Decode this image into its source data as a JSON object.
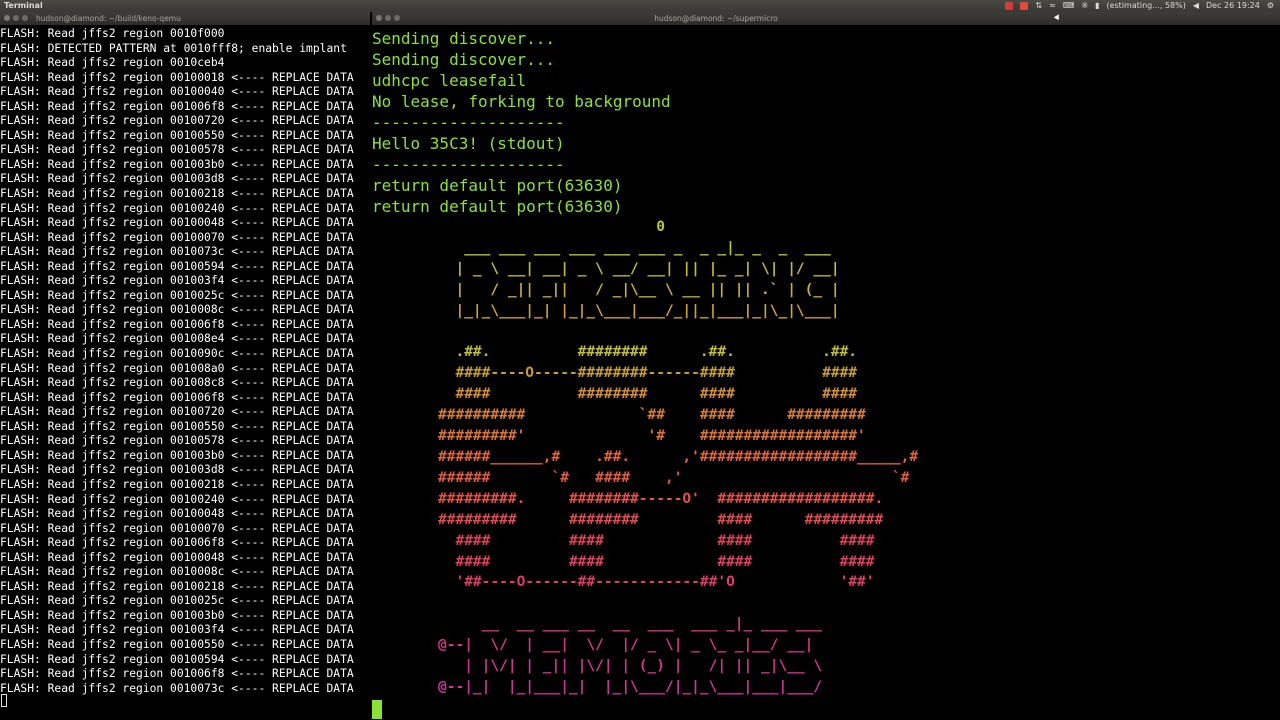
{
  "topbar": {
    "app_name": "Terminal",
    "battery": "(estimating..., 58%)",
    "clock": "Dec 26 19:24",
    "tray_colors": [
      "#d43b3b",
      "#e04a3a"
    ]
  },
  "left_window": {
    "title": "hudson@diamond: ~/build/keno-qemu",
    "log_lines": [
      "FLASH: Read jffs2 region 0010f000",
      "FLASH: DETECTED PATTERN at 0010fff8; enable implant",
      "FLASH: Read jffs2 region 0010ceb4",
      "FLASH: Read jffs2 region 00100018 <---- REPLACE DATA",
      "FLASH: Read jffs2 region 00100040 <---- REPLACE DATA",
      "FLASH: Read jffs2 region 001006f8 <---- REPLACE DATA",
      "FLASH: Read jffs2 region 00100720 <---- REPLACE DATA",
      "FLASH: Read jffs2 region 00100550 <---- REPLACE DATA",
      "FLASH: Read jffs2 region 00100578 <---- REPLACE DATA",
      "FLASH: Read jffs2 region 001003b0 <---- REPLACE DATA",
      "FLASH: Read jffs2 region 001003d8 <---- REPLACE DATA",
      "FLASH: Read jffs2 region 00100218 <---- REPLACE DATA",
      "FLASH: Read jffs2 region 00100240 <---- REPLACE DATA",
      "FLASH: Read jffs2 region 00100048 <---- REPLACE DATA",
      "FLASH: Read jffs2 region 00100070 <---- REPLACE DATA",
      "FLASH: Read jffs2 region 0010073c <---- REPLACE DATA",
      "FLASH: Read jffs2 region 00100594 <---- REPLACE DATA",
      "FLASH: Read jffs2 region 001003f4 <---- REPLACE DATA",
      "FLASH: Read jffs2 region 0010025c <---- REPLACE DATA",
      "FLASH: Read jffs2 region 0010008c <---- REPLACE DATA",
      "FLASH: Read jffs2 region 001006f8 <---- REPLACE DATA",
      "FLASH: Read jffs2 region 001008e4 <---- REPLACE DATA",
      "FLASH: Read jffs2 region 0010090c <---- REPLACE DATA",
      "FLASH: Read jffs2 region 001008a0 <---- REPLACE DATA",
      "FLASH: Read jffs2 region 001008c8 <---- REPLACE DATA",
      "FLASH: Read jffs2 region 001006f8 <---- REPLACE DATA",
      "FLASH: Read jffs2 region 00100720 <---- REPLACE DATA",
      "FLASH: Read jffs2 region 00100550 <---- REPLACE DATA",
      "FLASH: Read jffs2 region 00100578 <---- REPLACE DATA",
      "FLASH: Read jffs2 region 001003b0 <---- REPLACE DATA",
      "FLASH: Read jffs2 region 001003d8 <---- REPLACE DATA",
      "FLASH: Read jffs2 region 00100218 <---- REPLACE DATA",
      "FLASH: Read jffs2 region 00100240 <---- REPLACE DATA",
      "FLASH: Read jffs2 region 00100048 <---- REPLACE DATA",
      "FLASH: Read jffs2 region 00100070 <---- REPLACE DATA",
      "FLASH: Read jffs2 region 001006f8 <---- REPLACE DATA",
      "FLASH: Read jffs2 region 00100048 <---- REPLACE DATA",
      "FLASH: Read jffs2 region 0010008c <---- REPLACE DATA",
      "FLASH: Read jffs2 region 00100218 <---- REPLACE DATA",
      "FLASH: Read jffs2 region 0010025c <---- REPLACE DATA",
      "FLASH: Read jffs2 region 001003b0 <---- REPLACE DATA",
      "FLASH: Read jffs2 region 001003f4 <---- REPLACE DATA",
      "FLASH: Read jffs2 region 00100550 <---- REPLACE DATA",
      "FLASH: Read jffs2 region 00100594 <---- REPLACE DATA",
      "FLASH: Read jffs2 region 001006f8 <---- REPLACE DATA",
      "FLASH: Read jffs2 region 0010073c <---- REPLACE DATA"
    ]
  },
  "right_window": {
    "title": "hudson@diamond: ~/supermicro",
    "text_color": "#8ae234",
    "lines": [
      "Sending discover...",
      "Sending discover...",
      "udhcpc leasefail",
      "No lease, forking to background",
      "--------------------",
      "Hello 35C3! (stdout)",
      "--------------------",
      "return default port(63630)",
      "return default port(63630)"
    ],
    "art_colors": [
      "#b9c932",
      "#b9c932",
      "#c2bd30",
      "#c8b12f",
      "#cfa52f",
      "#c8b82f",
      "#c2bf34",
      "#c6a02f",
      "#d28e30",
      "#d67f33",
      "#dd7237",
      "#e0653b",
      "#e25b40",
      "#e35347",
      "#e04a50",
      "#dd4258",
      "#e0405e",
      "#e03c68",
      "#dc3a73",
      "#d8387e",
      "#d53689",
      "#d23593",
      "#cf359d",
      "#cc35a7"
    ],
    "art_lines": [
      "                         0",
      "   ___ ___ ___ ___ ___ ___ _  _ _|_ _  _  ___",
      "  | _ \\ __| __| _ \\ __/ __| || |_ _| \\| |/ __|",
      "  |   / _|| _||   / _|\\__ \\ __ || || .` | (_ |",
      "  |_|_\\___|_| |_|_\\___|___/_||_|___|_|\\_|\\___|",
      "",
      "  .##.          ########      .##.          .##.",
      "  ####----O-----########------####          ####",
      "  ####          ########      ####          ####",
      "##########             `##    ####      #########",
      "#########'              '#    ##################'",
      "######______,#    .##.      ,'##################_____,#",
      "######       `#   ####    ,'                        `#",
      "#########.     ########-----O'  ##################.",
      "#########      ########         ####      #########",
      "  ####         ####             ####          ####",
      "  ####         ####             ####          ####",
      "  '##----O------##------------##'O            '##'",
      "",
      "     __  __ ___ __  __  ___  ___ _|_ ___ ___",
      "@--|  \\/  | __|  \\/  |/ _ \\| _ \\_ _|__/ __|",
      "   | |\\/| | _|| |\\/| | (_) |   /| || _|\\__ \\",
      "@--|_|  |_|___|_|  |_|\\___/|_|_\\___|___|___/"
    ]
  }
}
